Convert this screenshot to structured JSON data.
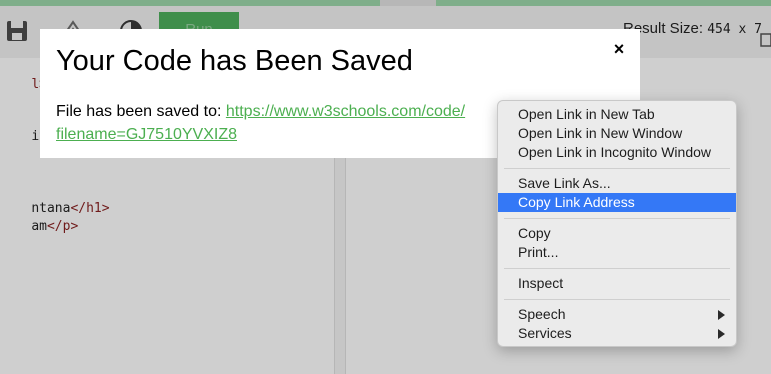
{
  "toolbar": {
    "save_icon": "save-icon",
    "rotate_icon": "rotate-icon",
    "theme_icon": "contrast-icon",
    "run_label": "Run",
    "result_size_label": "Result Size:",
    "result_size_value": "454 x 7"
  },
  "code_lines": [
    {
      "pre": "",
      "tag": "l>",
      "post": ""
    },
    {
      "pre": "itle",
      "tag": "</",
      "post": ""
    },
    {
      "pre": "ntana",
      "tag": "</h1>",
      "post": ""
    },
    {
      "pre": "am",
      "tag": "</p>",
      "post": ""
    }
  ],
  "modal": {
    "title": "Your Code has Been Saved",
    "close_label": "×",
    "text_prefix": "File has been saved to: ",
    "link_text_line1": "https://www.w3schools.com/code/",
    "link_text_line2": "filename=GJ7510YVXIZ8"
  },
  "context_menu": {
    "items": [
      {
        "label": "Open Link in New Tab"
      },
      {
        "label": "Open Link in New Window"
      },
      {
        "label": "Open Link in Incognito Window"
      },
      {
        "label": "Save Link As..."
      },
      {
        "label": "Copy Link Address",
        "selected": true
      },
      {
        "label": "Copy"
      },
      {
        "label": "Print..."
      },
      {
        "label": "Inspect"
      },
      {
        "label": "Speech",
        "submenu": true
      },
      {
        "label": "Services",
        "submenu": true
      }
    ]
  },
  "colors": {
    "accent_green": "#4caf50",
    "menu_highlight": "#3478f6",
    "run_button": "#3f8e4b"
  }
}
